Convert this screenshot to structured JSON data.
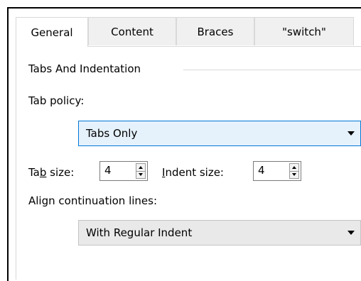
{
  "tabs": [
    {
      "label": "General",
      "active": true
    },
    {
      "label": "Content",
      "active": false
    },
    {
      "label": "Braces",
      "active": false
    },
    {
      "label": "\"switch\"",
      "active": false
    }
  ],
  "group": {
    "title": "Tabs And Indentation"
  },
  "tab_policy": {
    "label": "Tab policy:",
    "value": "Tabs Only"
  },
  "tab_size": {
    "label_pre": "Ta",
    "label_ul": "b",
    "label_post": " size:",
    "value": "4"
  },
  "indent_size": {
    "label_ul": "I",
    "label_post": "ndent size:",
    "value": "4"
  },
  "align": {
    "label": "Align continuation lines:",
    "value": "With Regular Indent"
  },
  "colors": {
    "accent": "#0078d7",
    "focus_bg": "#e5f1fb"
  }
}
